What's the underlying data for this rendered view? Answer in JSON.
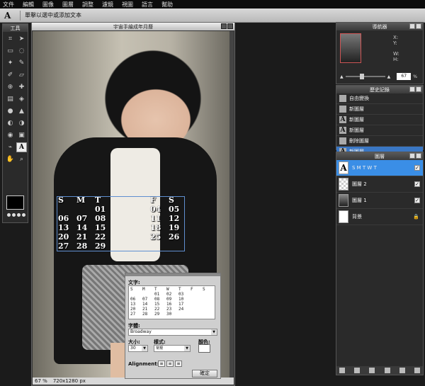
{
  "menubar": [
    "文件",
    "編輯",
    "圖像",
    "圖層",
    "調整",
    "濾鏡",
    "視圖",
    "語言",
    "幫助"
  ],
  "options_bar": {
    "tool_icon": "A",
    "hint": "單擊以選中或添加文本"
  },
  "toolbox": {
    "title": "工具",
    "tools": [
      "crop-icon",
      "move-icon",
      "marquee-icon",
      "lasso-icon",
      "wand-icon",
      "pencil-icon",
      "brush-icon",
      "eraser-icon",
      "clone-icon",
      "heal-icon",
      "gradient-icon",
      "bucket-icon",
      "blur-icon",
      "sharpen-icon",
      "dodge-icon",
      "burn-icon",
      "redeye-icon",
      "sponge-icon",
      "eyedropper-icon",
      "type-icon",
      "hand-icon",
      "zoom-icon"
    ],
    "active_tool_label": "A"
  },
  "document": {
    "title": "宇宙手繪成年月曆",
    "zoom": "67",
    "zoom_unit": "%",
    "dimensions": "720x1280 px"
  },
  "calendar_overlay": {
    "rows": [
      [
        "S",
        "M",
        "T",
        "",
        "",
        "F",
        "S"
      ],
      [
        "",
        "",
        "01",
        "",
        "",
        "04",
        "05"
      ],
      [
        "06",
        "07",
        "08",
        "",
        "",
        "11",
        "12"
      ],
      [
        "13",
        "14",
        "15",
        "",
        "",
        "18",
        "19"
      ],
      [
        "20",
        "21",
        "22",
        "",
        "",
        "25",
        "26"
      ],
      [
        "27",
        "28",
        "29",
        "",
        "",
        "",
        ""
      ]
    ]
  },
  "text_dialog": {
    "text_label": "文字:",
    "text_rows": [
      [
        "S",
        "M",
        "T",
        "W",
        "T",
        "F",
        "S"
      ],
      [
        "",
        "",
        "01",
        "02",
        "03",
        "",
        ""
      ],
      [
        "06",
        "07",
        "08",
        "09",
        "10",
        "",
        ""
      ],
      [
        "13",
        "14",
        "15",
        "16",
        "17",
        "",
        ""
      ],
      [
        "20",
        "21",
        "22",
        "23",
        "24",
        "",
        ""
      ],
      [
        "27",
        "28",
        "29",
        "30",
        "",
        "",
        ""
      ]
    ],
    "font_label": "字體:",
    "font_value": "Broadway",
    "size_label": "大小:",
    "size_value": "30",
    "style_label": "樣式:",
    "style_value": "常規",
    "color_label": "顏色:",
    "text_color": "#ffffff",
    "alignment_label": "Alignment:",
    "ok_label": "確定"
  },
  "navigator": {
    "title": "導航器",
    "x_label": "X:",
    "y_label": "Y:",
    "w_label": "W:",
    "h_label": "H:",
    "zoom_value": "67",
    "zoom_unit": "%"
  },
  "history": {
    "title": "歷史記錄",
    "items": [
      {
        "label": "自由變換",
        "icon": "transform-icon",
        "glyph": "",
        "selected": false
      },
      {
        "label": "新圖層",
        "icon": "layer-icon",
        "glyph": "",
        "selected": false
      },
      {
        "label": "新圖層",
        "icon": "type-icon",
        "glyph": "A",
        "selected": false
      },
      {
        "label": "新圖層",
        "icon": "type-icon",
        "glyph": "A",
        "selected": false
      },
      {
        "label": "刪除圖層",
        "icon": "delete-icon",
        "glyph": "",
        "selected": false
      },
      {
        "label": "新圖層",
        "icon": "type-icon",
        "glyph": "A",
        "selected": true
      }
    ]
  },
  "layers": {
    "title": "圖層",
    "items": [
      {
        "label": "S  M  T  W  T",
        "thumb": "A",
        "visible": true,
        "locked": false,
        "selected": true
      },
      {
        "label": "圖層 2",
        "thumb": "",
        "visible": true,
        "locked": false,
        "selected": false
      },
      {
        "label": "圖層 1",
        "thumb": "",
        "visible": true,
        "locked": false,
        "selected": false
      },
      {
        "label": "背景",
        "thumb": "",
        "visible": false,
        "locked": true,
        "selected": false
      }
    ]
  },
  "colors": {
    "accent": "#3a8ee6",
    "selection_border": "#5f8fd0",
    "foreground": "#000000"
  }
}
